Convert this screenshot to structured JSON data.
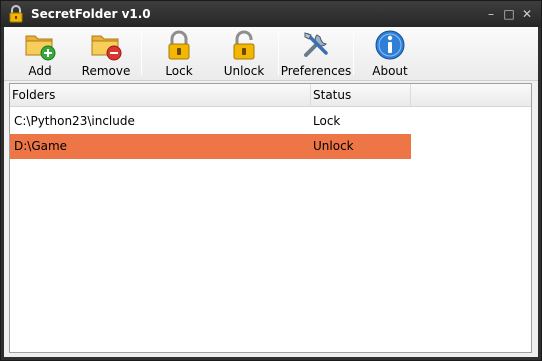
{
  "window": {
    "title": "SecretFolder v1.0",
    "minimize": "–",
    "maximize": "□",
    "close": "✕"
  },
  "toolbar": {
    "add_label": "Add",
    "remove_label": "Remove",
    "lock_label": "Lock",
    "unlock_label": "Unlock",
    "preferences_label": "Preferences",
    "about_label": "About"
  },
  "list": {
    "columns": [
      "Folders",
      "Status"
    ],
    "rows": [
      {
        "folder": "C:\\Python23\\include",
        "status": "Lock",
        "selected": false
      },
      {
        "folder": "D:\\Game",
        "status": "Unlock",
        "selected": true
      }
    ]
  },
  "colors": {
    "selection": "#ee7546",
    "accent": "#f2b705"
  }
}
